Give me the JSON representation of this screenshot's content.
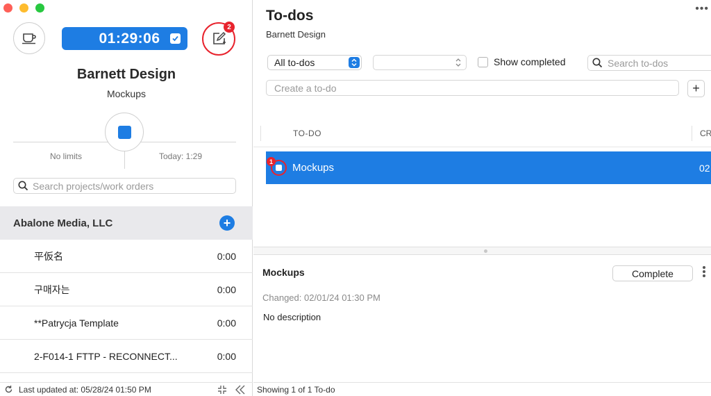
{
  "left": {
    "timer": "01:29:06",
    "note_badge": "2",
    "client": "Barnett Design",
    "project": "Mockups",
    "limit_left": "No limits",
    "limit_right": "Today: 1:29",
    "search_placeholder": "Search projects/work orders",
    "client_group": "Abalone Media, LLC",
    "work_orders": [
      {
        "name": "平仮名",
        "time": "0:00"
      },
      {
        "name": "구매자는",
        "time": "0:00"
      },
      {
        "name": "**Patrycja Template",
        "time": "0:00"
      },
      {
        "name": "2-F014-1 FTTP - RECONNECT...",
        "time": "0:00"
      }
    ],
    "footer": "Last updated at: 05/28/24 01:50 PM"
  },
  "right": {
    "title": "To-dos",
    "subtitle": "Barnett Design",
    "filter": "All to-dos",
    "show_completed": "Show completed",
    "search_placeholder": "Search to-dos",
    "create_placeholder": "Create a to-do",
    "plus": "+",
    "columns": {
      "todo": "TO-DO",
      "cr": "CR"
    },
    "rows": [
      {
        "title": "Mockups",
        "badge": "1",
        "cr": "02"
      }
    ],
    "detail": {
      "title": "Mockups",
      "complete_label": "Complete",
      "changed": "Changed: 02/01/24 01:30 PM",
      "description": "No description"
    },
    "footer": "Showing 1 of 1 To-do"
  },
  "colors": {
    "accent": "#1e7de3",
    "alert": "#e8232d"
  }
}
